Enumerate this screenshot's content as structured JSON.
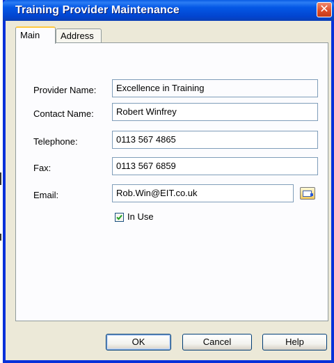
{
  "window": {
    "title": "Training Provider Maintenance",
    "close_symbol": "✕"
  },
  "tabs": [
    {
      "label": "Main",
      "active": true
    },
    {
      "label": "Address",
      "active": false
    }
  ],
  "form": {
    "provider_name_label": "Provider Name:",
    "provider_name_value": "Excellence in Training",
    "contact_name_label": "Contact Name:",
    "contact_name_value": "Robert Winfrey",
    "telephone_label": "Telephone:",
    "telephone_value": "0113 567 4865",
    "fax_label": "Fax:",
    "fax_value": "0113 567 6859",
    "email_label": "Email:",
    "email_value": "Rob.Win@EIT.co.uk",
    "in_use_label": "In Use",
    "in_use_checked": true
  },
  "buttons": {
    "ok": "OK",
    "cancel": "Cancel",
    "help": "Help"
  },
  "colors": {
    "titlebar": "#0a5ce4",
    "close": "#dc4a24",
    "dialog_bg": "#ece9d8",
    "tab_highlight": "#ffc83c"
  }
}
